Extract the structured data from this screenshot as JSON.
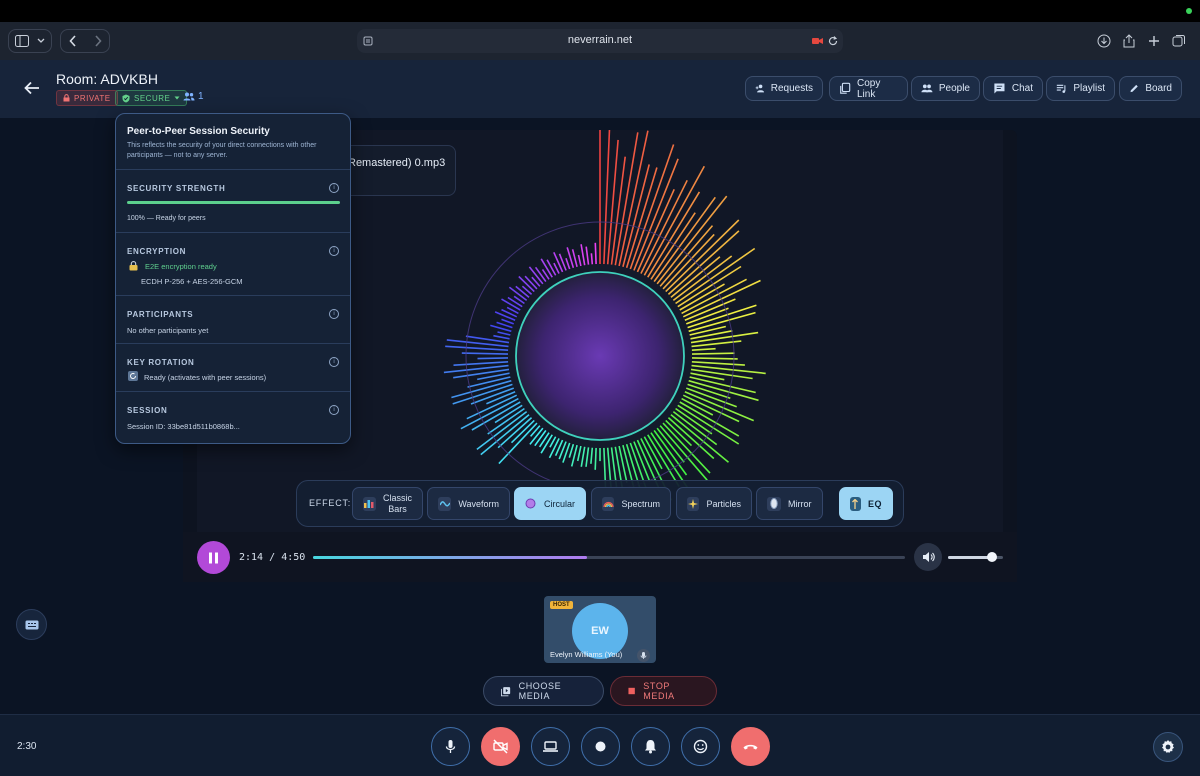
{
  "browser": {
    "url": "neverrain.net"
  },
  "header": {
    "room_title": "Room: ADVKBH",
    "private_badge": "PRIVATE",
    "secure_badge": "SECURE",
    "participant_count": "1",
    "buttons": [
      {
        "label": "Requests",
        "icon": "add-person-icon"
      },
      {
        "label": "Copy Link",
        "icon": "copy-icon"
      },
      {
        "label": "People",
        "icon": "people-icon"
      },
      {
        "label": "Chat",
        "icon": "chat-icon"
      },
      {
        "label": "Playlist",
        "icon": "playlist-icon"
      },
      {
        "label": "Board",
        "icon": "pencil-icon"
      }
    ]
  },
  "security_panel": {
    "title": "Peer-to-Peer Session Security",
    "description": "This reflects the security of your direct connections with other participants — not to any server.",
    "strength": {
      "heading": "SECURITY STRENGTH",
      "value_text": "100% — Ready for peers",
      "level": 1.0
    },
    "encryption": {
      "heading": "ENCRYPTION",
      "status": "E2E encryption ready",
      "detail": "ECDH P-256 + AES-256-GCM"
    },
    "participants": {
      "heading": "PARTICIPANTS",
      "text": "No other participants yet"
    },
    "key_rotation": {
      "heading": "KEY ROTATION",
      "text": "Ready (activates with peer sessions)"
    },
    "session": {
      "heading": "SESSION",
      "text": "Session ID: 33be81d511b0868b..."
    }
  },
  "player": {
    "now_playing": "Remastered) 0.mp3",
    "effect_label": "EFFECT:",
    "effects": [
      {
        "label_1": "Classic",
        "label_2": "Bars",
        "icon": "bar-chart-icon"
      },
      {
        "label": "Waveform",
        "icon": "wave-icon"
      },
      {
        "label": "Circular",
        "icon": "circle-icon",
        "active": true
      },
      {
        "label": "Spectrum",
        "icon": "rainbow-icon"
      },
      {
        "label": "Particles",
        "icon": "sparkle-icon"
      },
      {
        "label": "Mirror",
        "icon": "mirror-icon"
      }
    ],
    "eq_label": "EQ",
    "elapsed": "2:14",
    "separator": "/",
    "duration": "4:50",
    "progress": 0.4621,
    "volume": 0.8
  },
  "participant_tile": {
    "host_tag": "HOST",
    "initials": "EW",
    "name": "Evelyn Williams (You)"
  },
  "media_buttons": {
    "choose": "CHOOSE MEDIA",
    "stop": "STOP MEDIA"
  },
  "bottom_bar": {
    "clock": "2:30"
  },
  "colors": {
    "accent_purple": "#b249d8",
    "secure_green": "#63d28b",
    "danger_red": "#f06e6e",
    "active_effect": "#9cd5f4"
  }
}
